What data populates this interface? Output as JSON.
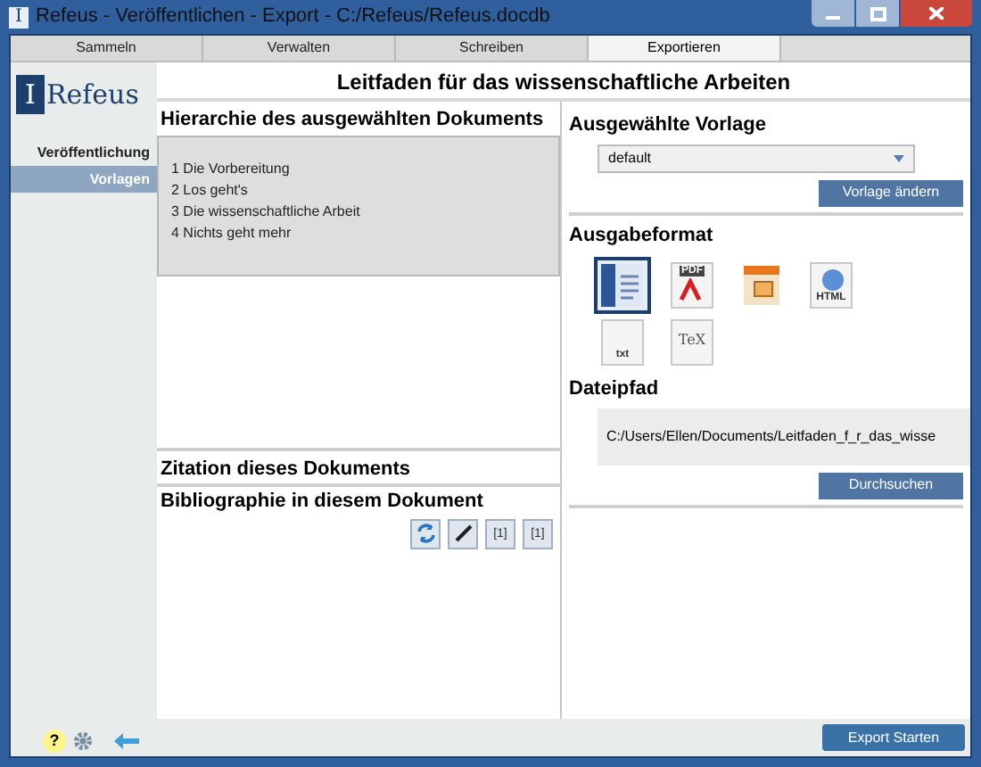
{
  "window": {
    "title": "Refeus - Veröffentlichen - Export - C:/Refeus/Refeus.docdb",
    "icon_mark": "I"
  },
  "tabs": [
    {
      "label": "Sammeln",
      "selected": false
    },
    {
      "label": "Verwalten",
      "selected": false
    },
    {
      "label": "Schreiben",
      "selected": false
    },
    {
      "label": "Exportieren",
      "selected": true
    }
  ],
  "sidebar": {
    "logo": "Refeus",
    "logo_mark": "I",
    "items": [
      {
        "label": "Veröffentlichung",
        "selected": false
      },
      {
        "label": "Vorlagen",
        "selected": true
      }
    ]
  },
  "document_title": "Leitfaden für das wissenschaftliche Arbeiten",
  "hierarchy": {
    "title": "Hierarchie des ausgewählten Dokuments",
    "items": [
      "1 Die Vorbereitung",
      "2 Los geht's",
      "3 Die wissenschaftliche Arbeit",
      "4 Nichts geht mehr"
    ]
  },
  "citation": {
    "title": "Zitation dieses Dokuments"
  },
  "bibliography": {
    "title": "Bibliographie in diesem Dokument",
    "tools": [
      {
        "kind": "refresh"
      },
      {
        "kind": "edit"
      },
      {
        "kind": "cite",
        "label": "[1]"
      },
      {
        "kind": "cite",
        "label": "[1]"
      }
    ]
  },
  "template": {
    "title": "Ausgewählte Vorlage",
    "value": "default",
    "button": "Vorlage ändern"
  },
  "output_format": {
    "title": "Ausgabeformat",
    "formats": [
      {
        "kind": "word",
        "selected": true
      },
      {
        "kind": "pdf",
        "label": "PDF",
        "selected": false
      },
      {
        "kind": "presentation",
        "selected": false
      },
      {
        "kind": "html",
        "label": "HTML",
        "selected": false
      },
      {
        "kind": "txt",
        "label": "txt",
        "selected": false
      },
      {
        "kind": "tex",
        "label": "TeX",
        "selected": false
      }
    ]
  },
  "file_path": {
    "title": "Dateipfad",
    "value": "C:/Users/Ellen/Documents/Leitfaden_f_r_das_wisse",
    "button": "Durchsuchen"
  },
  "help_button": "?",
  "export_button": "Export Starten"
}
